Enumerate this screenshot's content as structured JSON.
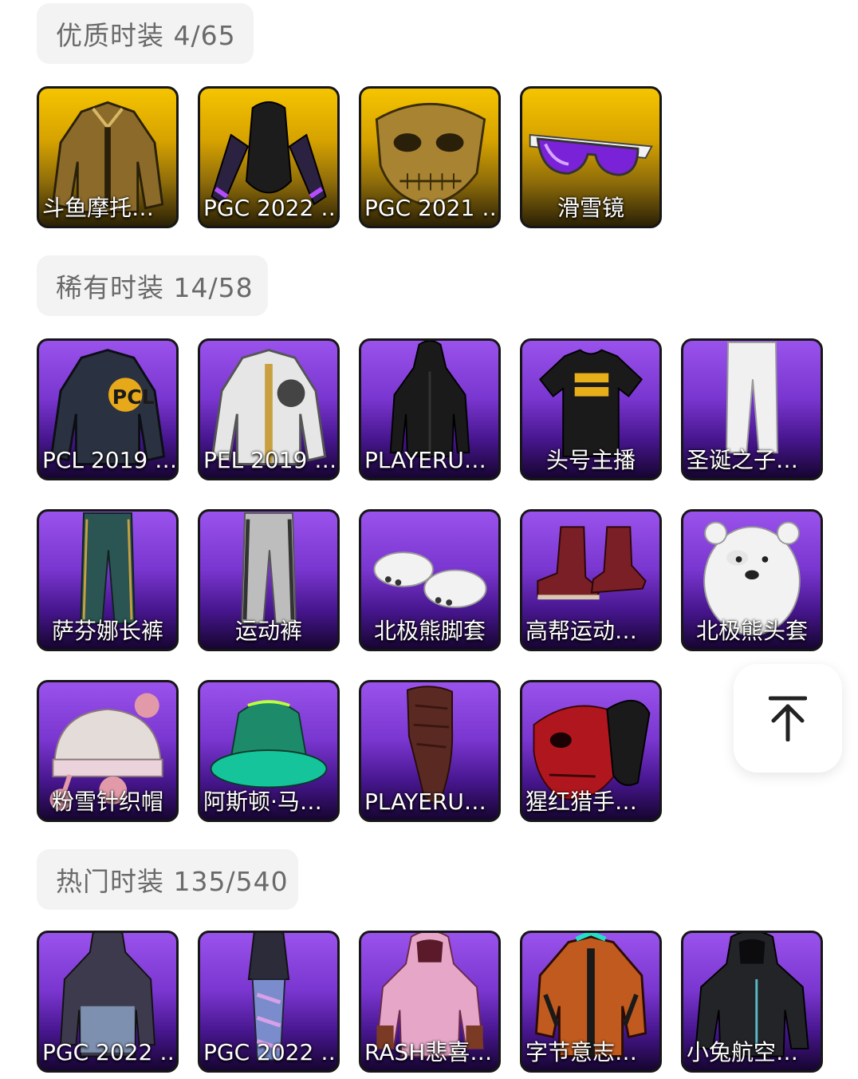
{
  "sections": [
    {
      "label": "优质时装 4/65",
      "items": [
        {
          "name": "斗鱼摩托…",
          "icon": "jacket-icon"
        },
        {
          "name": "PGC 2022 …",
          "icon": "vest-gloves-icon"
        },
        {
          "name": "PGC 2021 …",
          "icon": "mask-icon"
        },
        {
          "name": "滑雪镜",
          "icon": "goggles-icon"
        }
      ]
    },
    {
      "label": "稀有时装 14/58",
      "items": [
        {
          "name": "PCL 2019 …",
          "icon": "jacket-icon"
        },
        {
          "name": "PEL 2019 …",
          "icon": "jacket-icon"
        },
        {
          "name": "PLAYERU…",
          "icon": "coat-icon"
        },
        {
          "name": "头号主播",
          "icon": "tshirt-icon"
        },
        {
          "name": "圣诞之子…",
          "icon": "pants-icon"
        },
        {
          "name": "萨芬娜长裤",
          "icon": "pants-icon"
        },
        {
          "name": "运动裤",
          "icon": "pants-icon"
        },
        {
          "name": "北极熊脚套",
          "icon": "paws-icon"
        },
        {
          "name": "高帮运动…",
          "icon": "boots-icon"
        },
        {
          "name": "北极熊头套",
          "icon": "bear-head-icon"
        },
        {
          "name": "粉雪针织帽",
          "icon": "beanie-icon"
        },
        {
          "name": "阿斯顿·马…",
          "icon": "bucket-hat-icon"
        },
        {
          "name": "PLAYERU…",
          "icon": "scarf-icon"
        },
        {
          "name": "猩红猎手…",
          "icon": "mask-icon"
        }
      ]
    },
    {
      "label": "热门时装 135/540",
      "items": [
        {
          "name": "PGC 2022 …",
          "icon": "coat-icon"
        },
        {
          "name": "PGC 2022 …",
          "icon": "hood-scarf-icon"
        },
        {
          "name": "RASH悲喜…",
          "icon": "hoodie-icon"
        },
        {
          "name": "字节意志…",
          "icon": "jacket-icon"
        },
        {
          "name": "小兔航空…",
          "icon": "hooded-jacket-icon"
        }
      ]
    }
  ],
  "back_to_top": {
    "icon": "arrow-up-to-line-icon"
  }
}
